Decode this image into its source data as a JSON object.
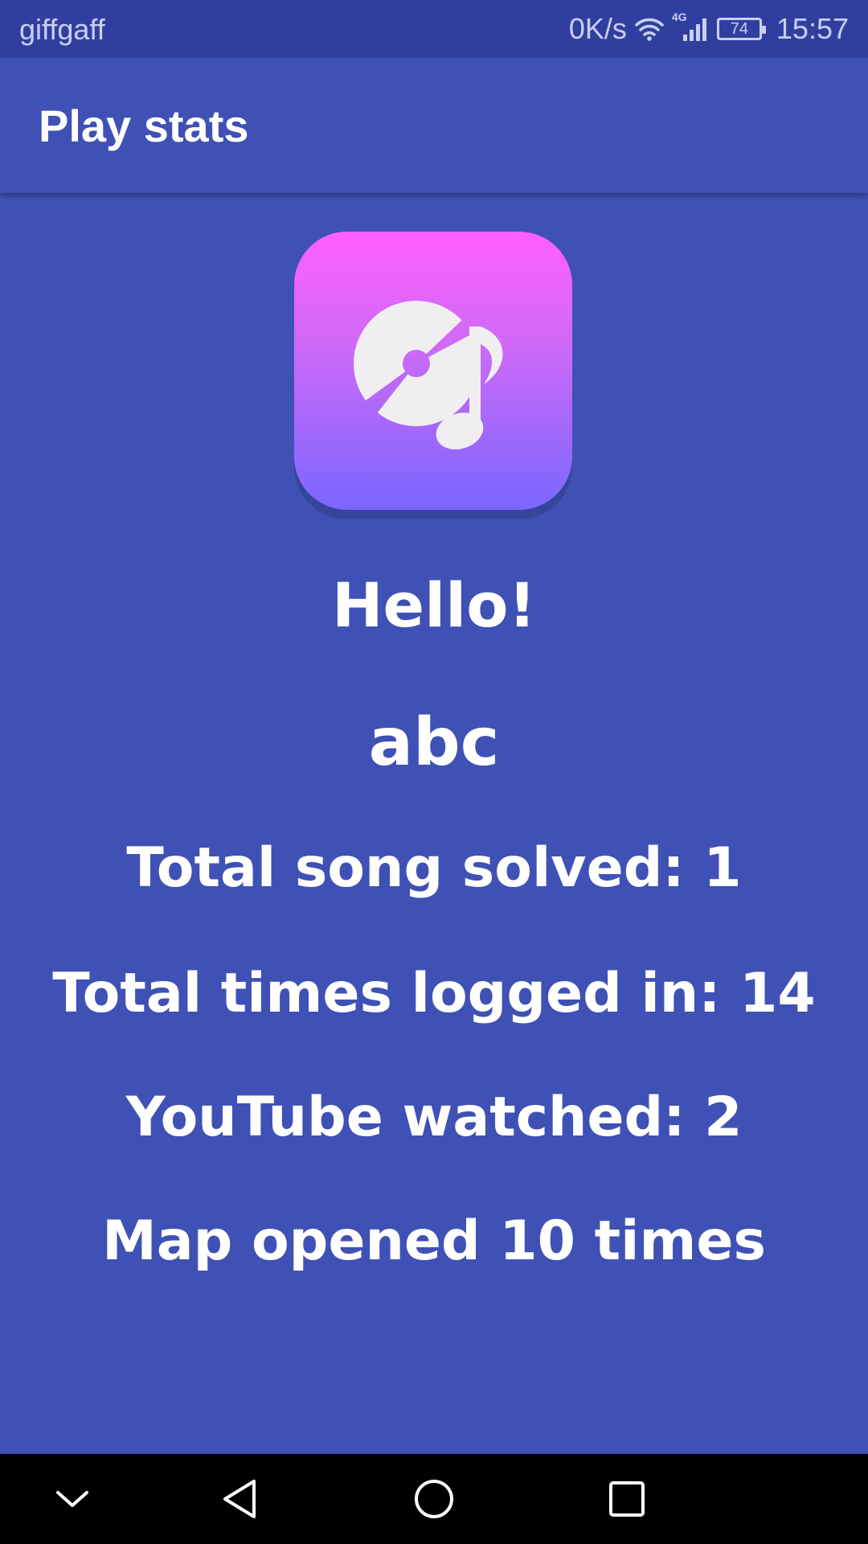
{
  "status_bar": {
    "carrier": "giffgaff",
    "speed": "0K/s",
    "network": "4G",
    "battery": "74",
    "time": "15:57"
  },
  "app_bar": {
    "title": "Play stats"
  },
  "icon": {
    "name": "music-disc-icon"
  },
  "stats": {
    "greeting": "Hello!",
    "username": "abc",
    "songs_solved": "Total song solved: 1",
    "times_logged_in": "Total times logged in: 14",
    "youtube_watched": "YouTube watched: 2",
    "map_opened": "Map opened 10 times"
  },
  "nav": {
    "icons": [
      "chevron-down-icon",
      "back-triangle-icon",
      "home-circle-icon",
      "recents-square-icon"
    ]
  },
  "colors": {
    "primary": "#3f51b5",
    "primary_dark": "#303f9f",
    "icon_gradient_top": "#ff5ffe",
    "icon_gradient_bottom": "#7a67ff"
  }
}
